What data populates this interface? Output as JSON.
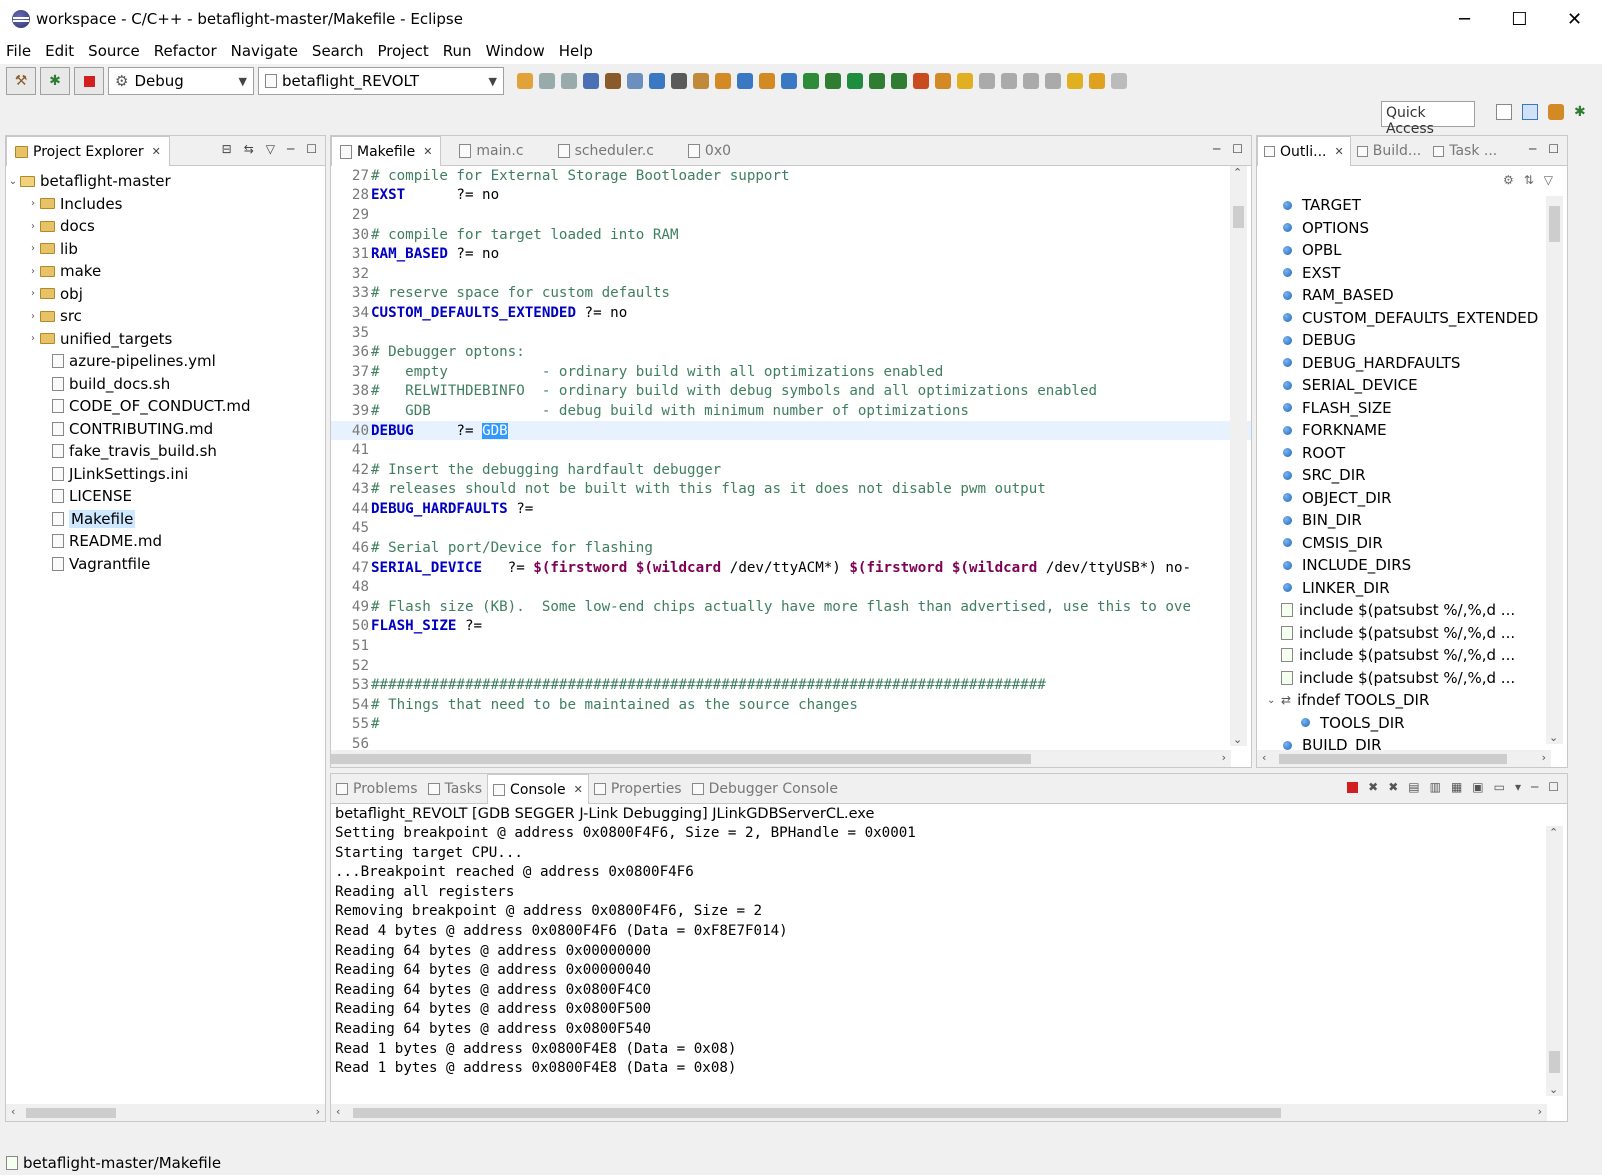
{
  "window": {
    "title": "workspace - C/C++ - betaflight-master/Makefile - Eclipse",
    "minimize": "─",
    "maximize": "☐",
    "close": "✕"
  },
  "menu": [
    "File",
    "Edit",
    "Source",
    "Refactor",
    "Navigate",
    "Search",
    "Project",
    "Run",
    "Window",
    "Help"
  ],
  "toolbar": {
    "build_config": "Debug",
    "launch_target": "betaflight_REVOLT",
    "quick_access": "Quick Access"
  },
  "project_explorer": {
    "tab_label": "Project Explorer",
    "root": "betaflight-master",
    "folders": [
      "Includes",
      "docs",
      "lib",
      "make",
      "obj",
      "src",
      "unified_targets"
    ],
    "files": [
      "azure-pipelines.yml",
      "build_docs.sh",
      "CODE_OF_CONDUCT.md",
      "CONTRIBUTING.md",
      "fake_travis_build.sh",
      "JLinkSettings.ini",
      "LICENSE",
      "Makefile",
      "README.md",
      "Vagrantfile"
    ],
    "selected": "Makefile"
  },
  "editor": {
    "tabs": [
      "Makefile",
      "main.c",
      "scheduler.c",
      "0x0"
    ],
    "lines": [
      {
        "n": "27",
        "t": "# compile for External Storage Bootloader support"
      },
      {
        "n": "28",
        "t": "EXST      ?= no"
      },
      {
        "n": "29",
        "t": ""
      },
      {
        "n": "30",
        "t": "# compile for target loaded into RAM"
      },
      {
        "n": "31",
        "t": "RAM_BASED ?= no"
      },
      {
        "n": "32",
        "t": ""
      },
      {
        "n": "33",
        "t": "# reserve space for custom defaults"
      },
      {
        "n": "34",
        "t": "CUSTOM_DEFAULTS_EXTENDED ?= no"
      },
      {
        "n": "35",
        "t": ""
      },
      {
        "n": "36",
        "t": "# Debugger optons:"
      },
      {
        "n": "37",
        "t": "#   empty           - ordinary build with all optimizations enabled"
      },
      {
        "n": "38",
        "t": "#   RELWITHDEBINFO  - ordinary build with debug symbols and all optimizations enabled"
      },
      {
        "n": "39",
        "t": "#   GDB             - debug build with minimum number of optimizations"
      },
      {
        "n": "40",
        "t": "DEBUG     ?= GDB"
      },
      {
        "n": "41",
        "t": ""
      },
      {
        "n": "42",
        "t": "# Insert the debugging hardfault debugger"
      },
      {
        "n": "43",
        "t": "# releases should not be built with this flag as it does not disable pwm output"
      },
      {
        "n": "44",
        "t": "DEBUG_HARDFAULTS ?="
      },
      {
        "n": "45",
        "t": ""
      },
      {
        "n": "46",
        "t": "# Serial port/Device for flashing"
      },
      {
        "n": "47",
        "t": "SERIAL_DEVICE   ?= $(firstword $(wildcard /dev/ttyACM*) $(firstword $(wildcard /dev/ttyUSB*) no-"
      },
      {
        "n": "48",
        "t": ""
      },
      {
        "n": "49",
        "t": "# Flash size (KB).  Some low-end chips actually have more flash than advertised, use this to ove"
      },
      {
        "n": "50",
        "t": "FLASH_SIZE ?="
      },
      {
        "n": "51",
        "t": ""
      },
      {
        "n": "52",
        "t": ""
      },
      {
        "n": "53",
        "t": "###############################################################################"
      },
      {
        "n": "54",
        "t": "# Things that need to be maintained as the source changes"
      },
      {
        "n": "55",
        "t": "#"
      },
      {
        "n": "56",
        "t": ""
      }
    ],
    "current_line": "40"
  },
  "outline": {
    "tabs": [
      "Outli...",
      "Build...",
      "Task ..."
    ],
    "items": [
      "TARGET",
      "OPTIONS",
      "OPBL",
      "EXST",
      "RAM_BASED",
      "CUSTOM_DEFAULTS_EXTENDED",
      "DEBUG",
      "DEBUG_HARDFAULTS",
      "SERIAL_DEVICE",
      "FLASH_SIZE",
      "FORKNAME",
      "ROOT",
      "SRC_DIR",
      "OBJECT_DIR",
      "BIN_DIR",
      "CMSIS_DIR",
      "INCLUDE_DIRS",
      "LINKER_DIR"
    ],
    "includes": [
      "include $(patsubst %/,%,d ...",
      "include $(patsubst %/,%,d ...",
      "include $(patsubst %/,%,d ...",
      "include $(patsubst %/,%,d ..."
    ],
    "ifndef": "ifndef TOOLS_DIR",
    "ifndef_child": "TOOLS_DIR",
    "last": "BUILD_DIR"
  },
  "bottom": {
    "tabs": [
      "Problems",
      "Tasks",
      "Console",
      "Properties",
      "Debugger Console"
    ],
    "active_tab": "Console",
    "console_header": "betaflight_REVOLT [GDB SEGGER J-Link Debugging] JLinkGDBServerCL.exe",
    "console_lines": [
      "Setting breakpoint @ address 0x0800F4F6, Size = 2, BPHandle = 0x0001",
      "Starting target CPU...",
      "...Breakpoint reached @ address 0x0800F4F6",
      "Reading all registers",
      "Removing breakpoint @ address 0x0800F4F6, Size = 2",
      "Read 4 bytes @ address 0x0800F4F6 (Data = 0xF8E7F014)",
      "Reading 64 bytes @ address 0x00000000",
      "Reading 64 bytes @ address 0x00000040",
      "Reading 64 bytes @ address 0x0800F4C0",
      "Reading 64 bytes @ address 0x0800F500",
      "Reading 64 bytes @ address 0x0800F540",
      "Read 1 bytes @ address 0x0800F4E8 (Data = 0x08)",
      "Read 1 bytes @ address 0x0800F4E8 (Data = 0x08)"
    ]
  },
  "status": {
    "path": "betaflight-master/Makefile"
  },
  "colors": {
    "comment": "#3f7f5f",
    "variable": "#0000c0",
    "function": "#7f0055",
    "selection": "#3399ff",
    "current_line": "#e8f2fe"
  }
}
